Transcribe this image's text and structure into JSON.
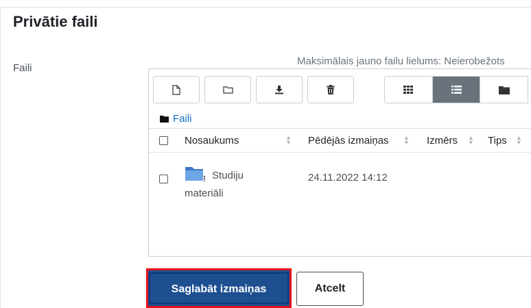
{
  "page": {
    "title": "Privātie faili"
  },
  "form": {
    "field_label": "Faili",
    "max_size_text": "Maksimālais jauno failu lielums: Neierobežots"
  },
  "toolbar": {
    "buttons": [
      "file-icon",
      "folder-icon",
      "download-icon",
      "trash-icon"
    ],
    "views": [
      "grid-icon",
      "list-icon",
      "folder-tree-icon"
    ],
    "active_view": "list-icon"
  },
  "breadcrumb": {
    "label": "Faili"
  },
  "table": {
    "headers": {
      "name": "Nosaukums",
      "modified": "Pēdējās izmaiņas",
      "size": "Izmērs",
      "type": "Tips"
    },
    "rows": [
      {
        "name": "Studiju materiāli",
        "name_line1": "Studiju",
        "name_line2": "materiāli",
        "modified": "24.11.2022 14:12",
        "size": "",
        "type": ""
      }
    ]
  },
  "actions": {
    "save_label": "Saglabāt izmaiņas",
    "cancel_label": "Atcelt"
  },
  "colors": {
    "primary": "#1d4f91",
    "highlight": "#e8101a",
    "link": "#0f6cbf",
    "active_view": "#6a737b"
  }
}
